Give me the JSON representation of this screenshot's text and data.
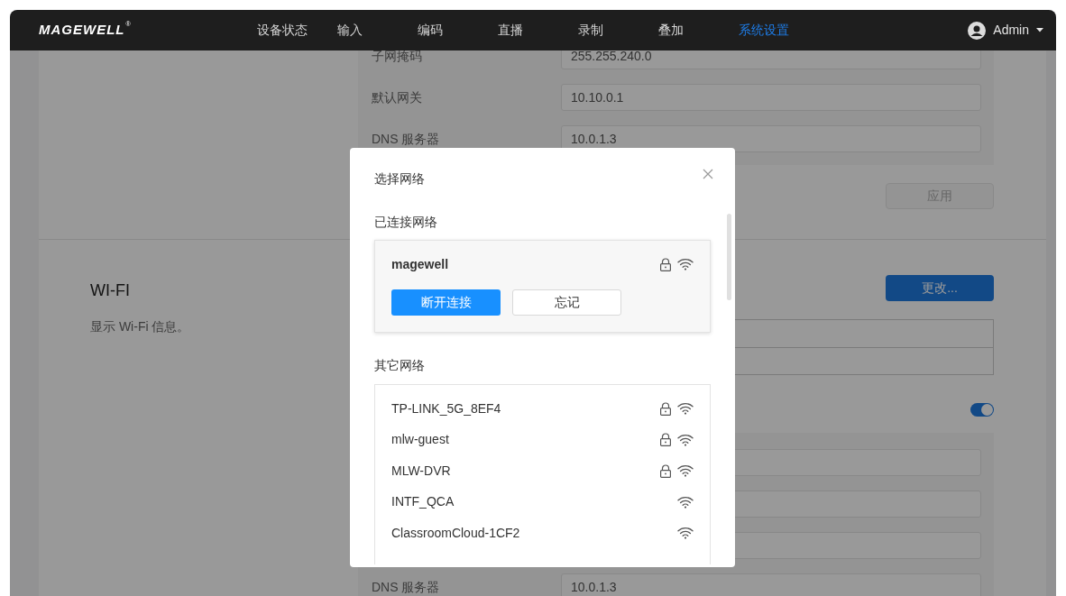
{
  "header": {
    "logo": "MAGEWELL",
    "logo_mark": "®",
    "nav": [
      {
        "label": "设备状态",
        "selected": false
      },
      {
        "label": "输入",
        "selected": false
      },
      {
        "label": "编码",
        "selected": false
      },
      {
        "label": "直播",
        "selected": false
      },
      {
        "label": "录制",
        "selected": false
      },
      {
        "label": "叠加",
        "selected": false
      },
      {
        "label": "系统设置",
        "selected": true
      }
    ],
    "user": "Admin"
  },
  "network_settings": {
    "rows": [
      {
        "label": "子网掩码",
        "value": "255.255.240.0"
      },
      {
        "label": "默认网关",
        "value": "10.10.0.1"
      },
      {
        "label": "DNS 服务器",
        "value": "10.0.1.3"
      }
    ],
    "apply_button": {
      "label": "应用",
      "disabled": true
    }
  },
  "wifi": {
    "title": "WI-FI",
    "description": "显示 Wi-Fi 信息。",
    "change_button": "更改...",
    "toggle": {
      "on": true
    },
    "rows": [
      {},
      {},
      {},
      {
        "label": "DNS 服务器",
        "value": "10.0.1.3"
      }
    ]
  },
  "dialog": {
    "title": "选择网络",
    "connected_heading": "已连接网络",
    "connected": {
      "name": "magewell",
      "locked": true,
      "disconnect_button": "断开连接",
      "forget_button": "忘记"
    },
    "other_heading": "其它网络",
    "networks": [
      {
        "name": "TP-LINK_5G_8EF4",
        "locked": true
      },
      {
        "name": "mlw-guest",
        "locked": true
      },
      {
        "name": "MLW-DVR",
        "locked": true
      },
      {
        "name": "INTF_QCA",
        "locked": false
      },
      {
        "name": "ClassroomCloud-1CF2",
        "locked": false
      }
    ]
  }
}
